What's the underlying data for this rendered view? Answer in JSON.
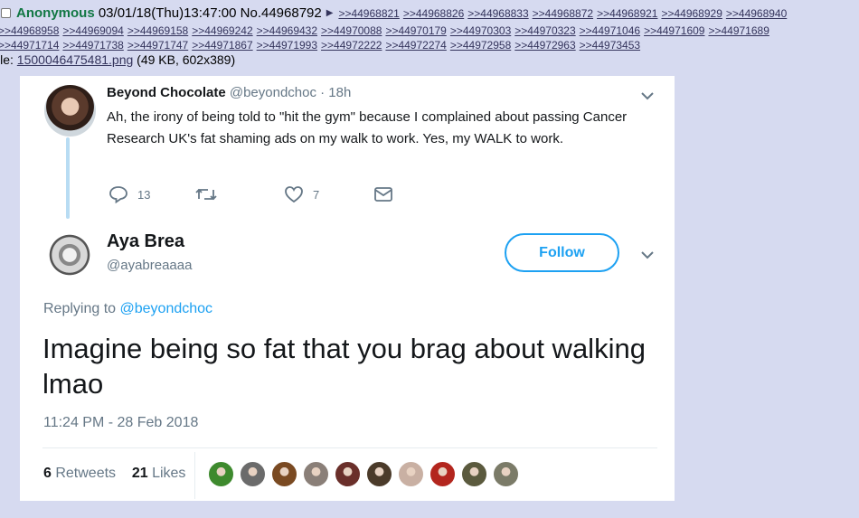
{
  "post": {
    "name": "Anonymous",
    "datetime": "03/01/18(Thu)13:47:00",
    "number": "No.44968792",
    "replies_line1": [
      ">>44968821",
      ">>44968826",
      ">>44968833",
      ">>44968872",
      ">>44968921",
      ">>44968929",
      ">>44968940"
    ],
    "replies_line2": [
      ">>44968958",
      ">>44969094",
      ">>44969158",
      ">>44969242",
      ">>44969432",
      ">>44970088",
      ">>44970179",
      ">>44970303",
      ">>44970323",
      ">>44971046",
      ">>44971609",
      ">>44971689"
    ],
    "replies_line3": [
      ">>44971714",
      ">>44971738",
      ">>44971747",
      ">>44971867",
      ">>44971993",
      ">>44972222",
      ">>44972274",
      ">>44972958",
      ">>44972963",
      ">>44973453"
    ],
    "file_prefix": "ile: ",
    "file_name": "1500046475481.png",
    "file_meta": " (49 KB, 602x389)"
  },
  "tweet1": {
    "display_name": "Beyond Chocolate",
    "handle_time": " @beyondchoc · 18h",
    "text": "Ah, the irony of being told to \"hit the gym\" because I complained about passing Cancer Research UK's fat shaming ads on my walk to work. Yes, my WALK to work.",
    "reply_count": "13",
    "like_count": "7"
  },
  "tweet2": {
    "display_name": "Aya Brea",
    "handle": "@ayabreaaaa",
    "follow_label": "Follow",
    "replying_prefix": "Replying to ",
    "replying_handle": "@beyondchoc",
    "text": "Imagine being so fat that you brag about walking lmao",
    "timestamp": "11:24 PM - 28 Feb 2018",
    "retweets_count": "6",
    "retweets_label": " Retweets",
    "likes_count": "21",
    "likes_label": " Likes"
  },
  "liker_colors": [
    "#3e8a2e",
    "#6b6b6b",
    "#7a4a22",
    "#8a7f78",
    "#6a2f2a",
    "#4b3b2a",
    "#c9b0a3",
    "#b3261e",
    "#5b5a3e",
    "#7b7b68"
  ],
  "colors": {
    "background": "#d6daf0",
    "name_green": "#117743",
    "link": "#34345c",
    "twitter_blue": "#1da1f2",
    "muted": "#657786"
  }
}
